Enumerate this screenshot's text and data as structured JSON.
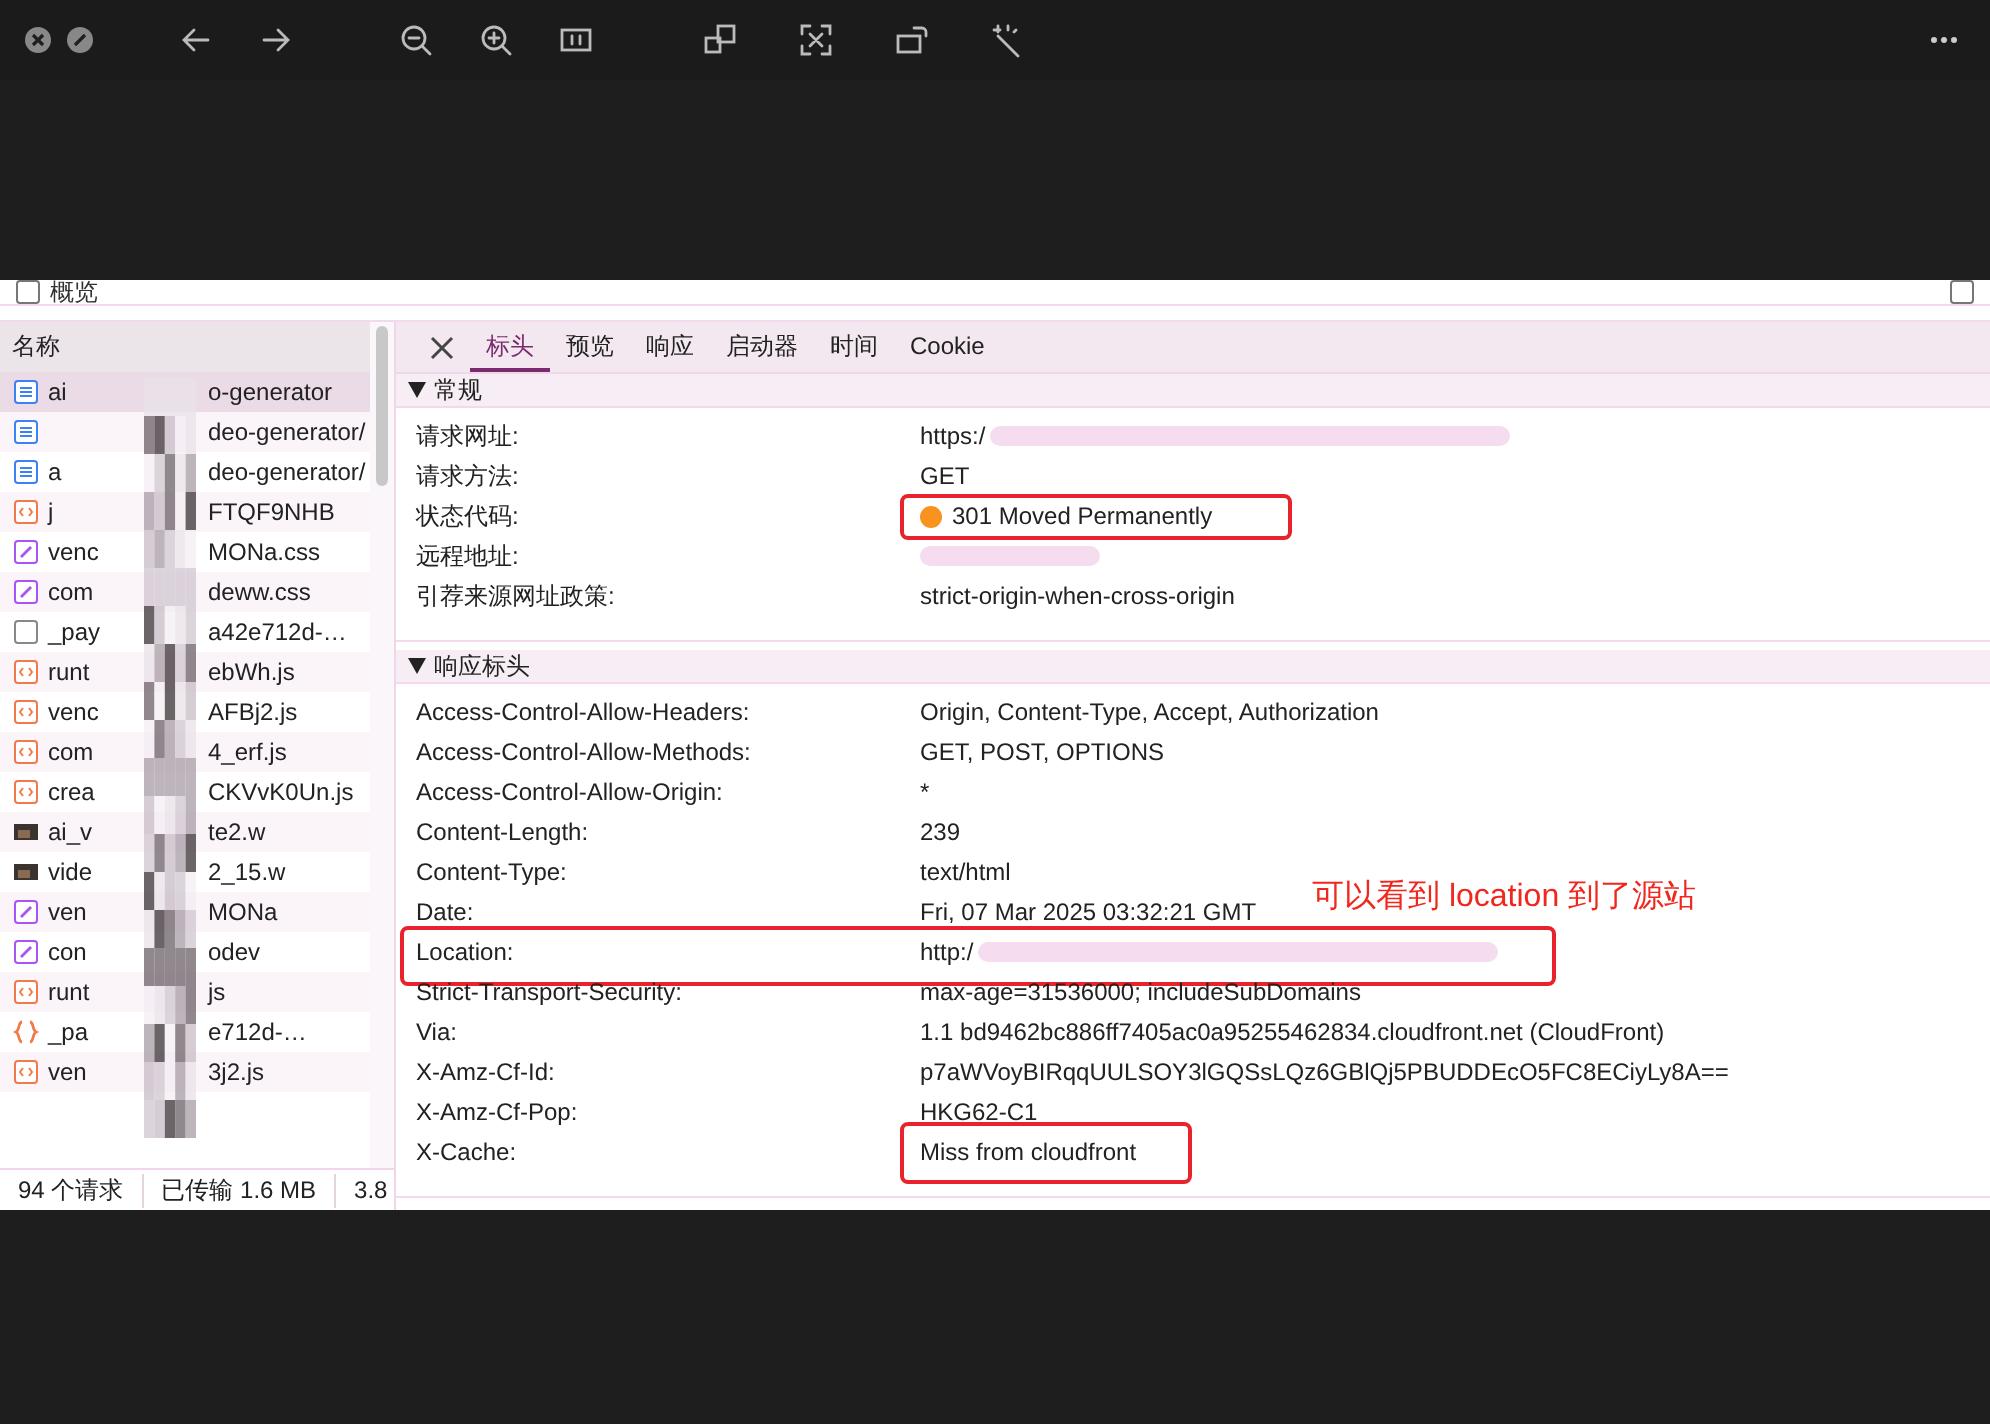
{
  "top_strip": {
    "overview": {
      "label": "概览",
      "checked": false
    },
    "right_checkbox": {
      "checked": false
    }
  },
  "request_list": {
    "header": "名称",
    "rows": [
      {
        "kind": "doc",
        "start": "ai",
        "end": "o-generator",
        "selected": true
      },
      {
        "kind": "doc",
        "end": "deo-generator/",
        "selected": false
      },
      {
        "kind": "doc",
        "start": "a",
        "end": "deo-generator/",
        "selected": false
      },
      {
        "kind": "js",
        "start": "j",
        "end": "FTQF9NHB",
        "selected": false
      },
      {
        "kind": "css",
        "start": "venc",
        "end": "MONa.css",
        "selected": false
      },
      {
        "kind": "css",
        "start": "com",
        "end": "deww.css",
        "selected": false
      },
      {
        "kind": "blank",
        "start": "_pay",
        "end": "a42e712d-…",
        "selected": false
      },
      {
        "kind": "js",
        "start": "runt",
        "end": "ebWh.js",
        "selected": false
      },
      {
        "kind": "js",
        "start": "venc",
        "end": "AFBj2.js",
        "selected": false
      },
      {
        "kind": "js",
        "start": "com",
        "end": "4_erf.js",
        "selected": false
      },
      {
        "kind": "js",
        "start": "crea",
        "end": "CKVvK0Un.js",
        "selected": false
      },
      {
        "kind": "image",
        "start": "ai_v",
        "end": "te2.w",
        "selected": false
      },
      {
        "kind": "image",
        "start": "vide",
        "end": "2_15.w",
        "selected": false
      },
      {
        "kind": "css",
        "start": "ven",
        "end": "MONa",
        "selected": false
      },
      {
        "kind": "css",
        "start": "con",
        "end": "odev",
        "selected": false
      },
      {
        "kind": "js",
        "start": "runt",
        "end": "js",
        "selected": false
      },
      {
        "kind": "json",
        "start": "_pa",
        "end": "e712d-…",
        "selected": false
      },
      {
        "kind": "js",
        "start": "ven",
        "end": "3j2.js",
        "selected": false
      }
    ]
  },
  "status_bar": [
    "94 个请求",
    "已传输 1.6 MB",
    "3.8"
  ],
  "detail": {
    "tabs": [
      {
        "label": "标头",
        "selected": true
      },
      {
        "label": "预览",
        "selected": false
      },
      {
        "label": "响应",
        "selected": false
      },
      {
        "label": "启动器",
        "selected": false
      },
      {
        "label": "时间",
        "selected": false
      },
      {
        "label": "Cookie",
        "selected": false
      }
    ],
    "sections": [
      {
        "title": "常规",
        "expanded": true,
        "rows": [
          {
            "name": "请求网址:",
            "value": "https:/",
            "redacted": true
          },
          {
            "name": "请求方法:",
            "value": "GET"
          },
          {
            "name": "状态代码:",
            "value": "301 Moved Permanently",
            "color": "#f7931e",
            "value_highlighted": true
          },
          {
            "name": "远程地址:",
            "redacted": true
          },
          {
            "name": "引荐来源网址政策:",
            "value": "strict-origin-when-cross-origin"
          }
        ]
      },
      {
        "title": "响应标头",
        "expanded": true,
        "rows": [
          {
            "name": "Access-Control-Allow-Headers:",
            "value": "Origin, Content-Type, Accept, Authorization"
          },
          {
            "name": "Access-Control-Allow-Methods:",
            "value": "GET, POST, OPTIONS"
          },
          {
            "name": "Access-Control-Allow-Origin:",
            "value": "*"
          },
          {
            "name": "Content-Length:",
            "value": "239"
          },
          {
            "name": "Content-Type:",
            "value": "text/html"
          },
          {
            "name": "Date:",
            "value": "Fri, 07 Mar 2025 03:32:21 GMT",
            "note": "可以看到 location 到了源站"
          },
          {
            "name": "Location:",
            "value": "http:/",
            "redacted": true,
            "row_highlighted": true
          },
          {
            "name": "Strict-Transport-Security:",
            "value": "max-age=31536000; includeSubDomains"
          },
          {
            "name": "Via:",
            "value": "1.1 bd9462bc886ff7405ac0a95255462834.cloudfront.net (CloudFront)"
          },
          {
            "name": "X-Amz-Cf-Id:",
            "value": "p7aWVoyBIRqqUULSOY3lGQSsLQz6GBlQj5PBUDDEcO5FC8ECiyLy8A=="
          },
          {
            "name": "X-Amz-Cf-Pop:",
            "value": "HKG62-C1"
          },
          {
            "name": "X-Cache:",
            "value": "Miss from cloudfront",
            "value_highlighted": true
          }
        ]
      }
    ]
  }
}
